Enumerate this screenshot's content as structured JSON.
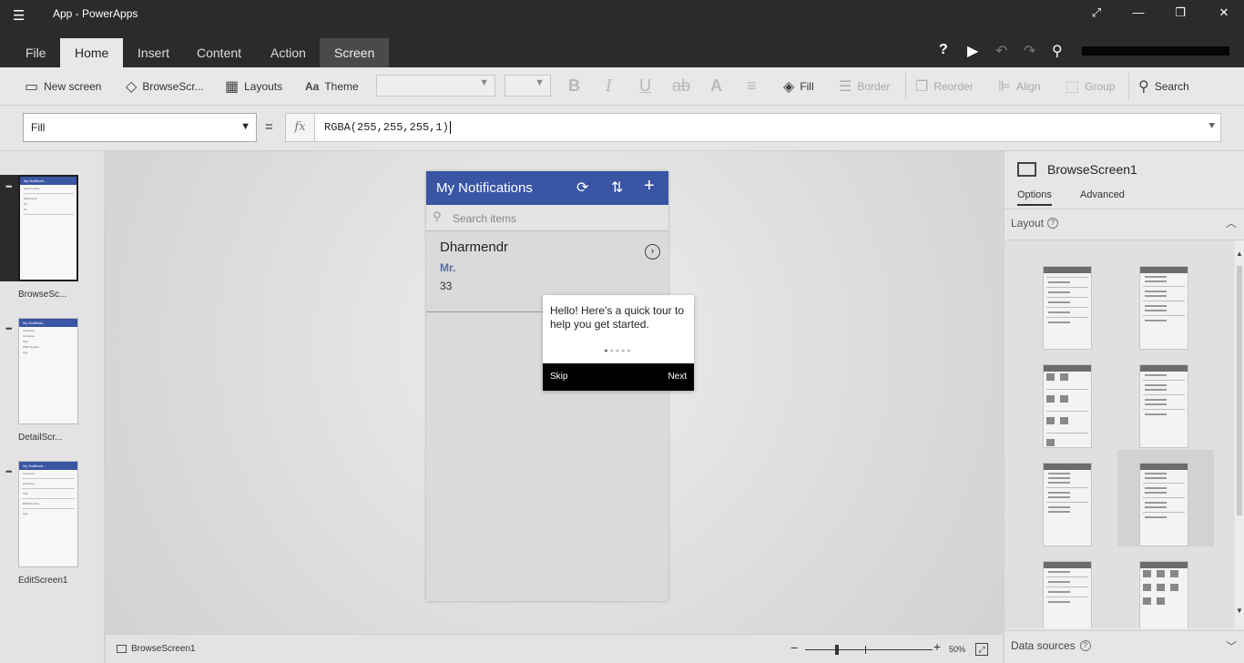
{
  "titlebar": {
    "title": "App - PowerApps"
  },
  "ribbon_tabs": [
    "File",
    "Home",
    "Insert",
    "Content",
    "Action",
    "Screen"
  ],
  "toolbar": {
    "new_screen": "New screen",
    "browse_screen": "BrowseScr...",
    "layouts": "Layouts",
    "theme": "Theme",
    "fill": "Fill",
    "border": "Border",
    "reorder": "Reorder",
    "align": "Align",
    "group": "Group",
    "search": "Search"
  },
  "formula_bar": {
    "property": "Fill",
    "equals": "=",
    "fx": "fx",
    "formula": "RGBA(255,255,255,1)"
  },
  "screens": [
    {
      "label": "BrowseSc..."
    },
    {
      "label": "DetailScr..."
    },
    {
      "label": "EditScreen1"
    }
  ],
  "thumbs": {
    "title": "My Notificati...",
    "browse_lines": [
      "Search items",
      "Dharmendr",
      "Mr.",
      "33"
    ],
    "detail_lines": [
      "Lastname",
      "Firstname",
      "Title",
      "EMP Number",
      "Age"
    ],
    "edit_lines": [
      "Lastname",
      "Firstname",
      "Title",
      "EMP Number",
      "Age"
    ]
  },
  "app": {
    "header_title": "My Notifications",
    "search_placeholder": "Search items",
    "item": {
      "name": "Dharmendr",
      "subtitle": "Mr.",
      "value": "33"
    }
  },
  "tour": {
    "message": "Hello! Here's a quick tour to help you get started.",
    "skip": "Skip",
    "next": "Next",
    "steps": 5,
    "current_step": 1
  },
  "statusbar": {
    "screen_name": "BrowseScreen1",
    "zoom": "50%",
    "zoom_level": 0.5
  },
  "right_panel": {
    "screen_name": "BrowseScreen1",
    "tabs": [
      "Options",
      "Advanced"
    ],
    "layout_label": "Layout",
    "data_sources_label": "Data sources"
  },
  "colors": {
    "accent": "#3955a3",
    "titlebar": "#2b2b2b"
  },
  "icons": [
    "hamburger-icon",
    "help-icon",
    "play-icon",
    "undo-icon",
    "redo-icon",
    "user-icon",
    "refresh-icon",
    "sort-icon",
    "add-icon",
    "search-icon",
    "chevron-right-icon"
  ]
}
